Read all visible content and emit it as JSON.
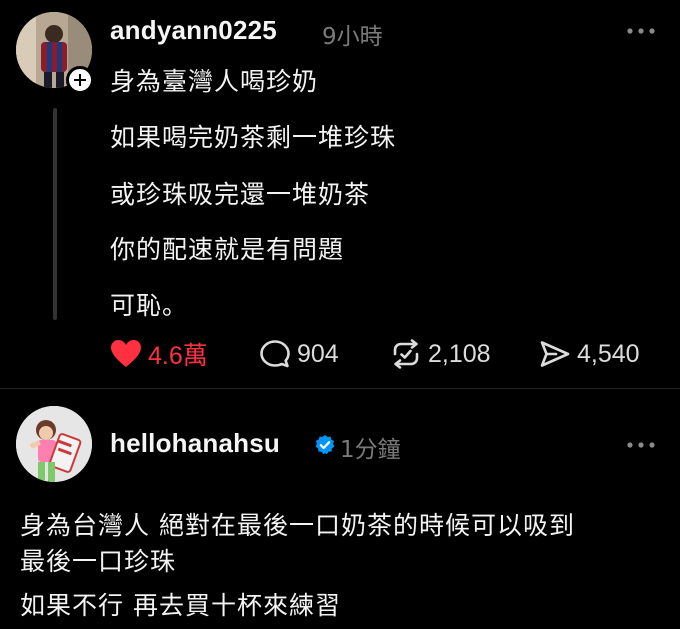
{
  "post": {
    "username": "andyann0225",
    "time": "9小時",
    "lines": [
      "身為臺灣人喝珍奶",
      "如果喝完奶茶剩一堆珍珠",
      "或珍珠吸完還一堆奶茶",
      "你的配速就是有問題",
      "可恥。"
    ],
    "actions": {
      "likes": "4.6萬",
      "comments": "904",
      "reposts": "2,108",
      "shares": "4,540"
    }
  },
  "reply": {
    "username": "hellohanahsu",
    "time": "1分鐘",
    "lines": [
      "身為台灣人 絕對在最後一口奶茶的時候可以吸到",
      "最後一口珍珠",
      "如果不行 再去買十杯來練習"
    ]
  },
  "colors": {
    "background": "#000000",
    "like_red": "#ff3040",
    "verified_blue": "#0095f6",
    "muted_text": "#7a7a7a"
  },
  "icons": {
    "post": [
      "follow-plus-icon",
      "more-options-icon",
      "heart-icon",
      "comment-icon",
      "repost-icon",
      "share-icon"
    ],
    "reply": [
      "verified-badge-icon",
      "more-options-icon"
    ]
  }
}
